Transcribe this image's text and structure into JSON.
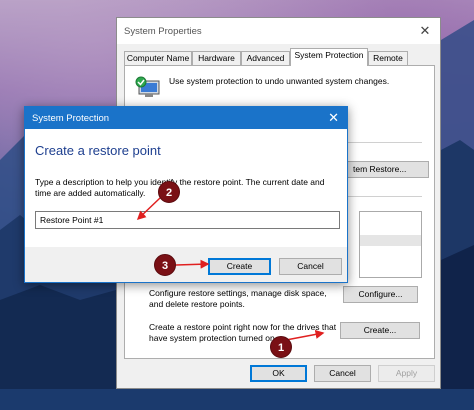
{
  "system_properties": {
    "title": "System Properties",
    "close_glyph": "✕",
    "tabs": [
      {
        "label": "Computer Name"
      },
      {
        "label": "Hardware"
      },
      {
        "label": "Advanced"
      },
      {
        "label": "System Protection"
      },
      {
        "label": "Remote"
      }
    ],
    "intro_text": "Use system protection to undo unwanted system changes.",
    "system_restore_label": "tem Restore...",
    "configure_text_line1": "Configure restore settings, manage disk space,",
    "configure_text_line2": "and delete restore points.",
    "configure_button": "Configure...",
    "create_text_line1": "Create a restore point right now for the drives that",
    "create_text_line2": "have system protection turned on.",
    "create_button": "Create...",
    "ok_button": "OK",
    "cancel_button": "Cancel",
    "apply_button": "Apply"
  },
  "dialog": {
    "title": "System Protection",
    "close_glyph": "✕",
    "heading": "Create a restore point",
    "description_line1": "Type a description to help you identify the restore point. The current date and",
    "description_line2": "time are added automatically.",
    "input_value": "Restore Point #1",
    "create_button": "Create",
    "cancel_button": "Cancel"
  },
  "markers": {
    "step1": "1",
    "step2": "2",
    "step3": "3"
  },
  "colors": {
    "dialog_title_bar": "#1a73c9",
    "heading": "#1e3f8f",
    "marker": "#7a1015"
  }
}
